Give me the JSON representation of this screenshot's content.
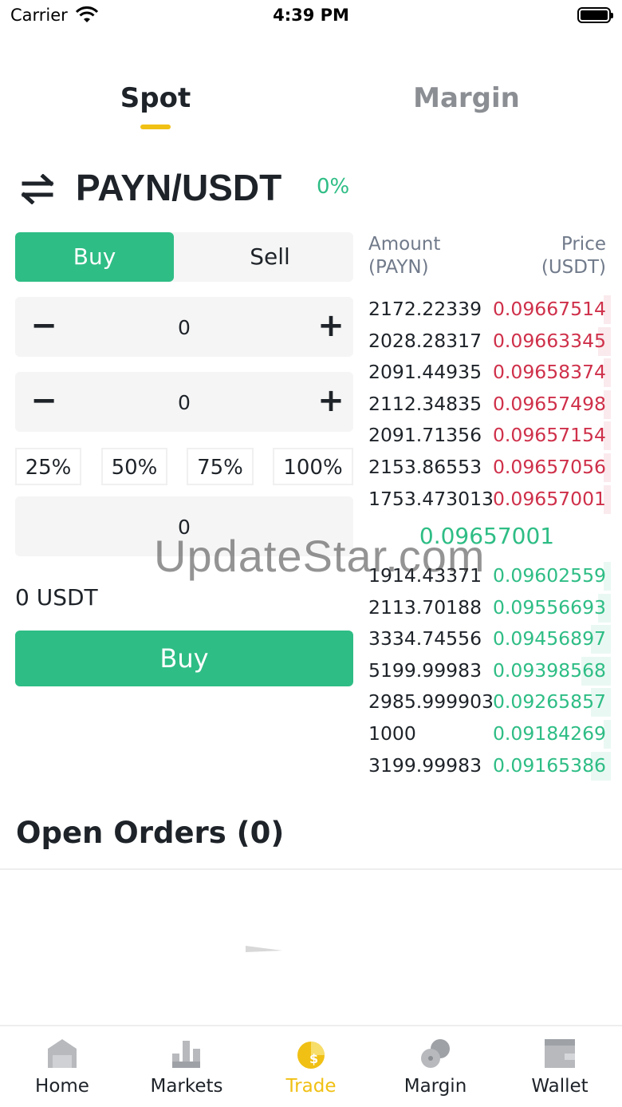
{
  "status_bar": {
    "carrier": "Carrier",
    "time": "4:39 PM"
  },
  "tabs": [
    {
      "label": "Spot",
      "active": true
    },
    {
      "label": "Margin",
      "active": false
    }
  ],
  "pair": {
    "name": "PAYN/USDT",
    "change": "0%"
  },
  "order_form": {
    "buy_label": "Buy",
    "sell_label": "Sell",
    "price_value": "0",
    "amount_value": "0",
    "percent_options": [
      "25%",
      "50%",
      "75%",
      "100%"
    ],
    "total_value": "0",
    "available": "0 USDT",
    "submit_label": "Buy"
  },
  "order_book": {
    "amount_header": [
      "Amount",
      "(PAYN)"
    ],
    "price_header": [
      "Price",
      "(USDT)"
    ],
    "asks": [
      {
        "amount": "2172.22339",
        "price": "0.09667514",
        "depth": 0.03
      },
      {
        "amount": "2028.28317",
        "price": "0.09663345",
        "depth": 0.05
      },
      {
        "amount": "2091.44935",
        "price": "0.09658374",
        "depth": 0.03
      },
      {
        "amount": "2112.34835",
        "price": "0.09657498",
        "depth": 0.03
      },
      {
        "amount": "2091.71356",
        "price": "0.09657154",
        "depth": 0.03
      },
      {
        "amount": "2153.86553",
        "price": "0.09657056",
        "depth": 0.03
      },
      {
        "amount": "1753.473013",
        "price": "0.09657001",
        "depth": 0.03
      }
    ],
    "last_price": "0.09657001",
    "bids": [
      {
        "amount": "1914.43371",
        "price": "0.09602559",
        "depth": 0.03
      },
      {
        "amount": "2113.70188",
        "price": "0.09556693",
        "depth": 0.05
      },
      {
        "amount": "3334.74556",
        "price": "0.09456897",
        "depth": 0.08
      },
      {
        "amount": "5199.99983",
        "price": "0.09398568",
        "depth": 0.12
      },
      {
        "amount": "2985.999903",
        "price": "0.09265857",
        "depth": 0.08
      },
      {
        "amount": "1000",
        "price": "0.09184269",
        "depth": 0.03
      },
      {
        "amount": "3199.99983",
        "price": "0.09165386",
        "depth": 0.08
      }
    ]
  },
  "watermark": "UpdateStar.com",
  "open_orders": {
    "title": "Open Orders (0)"
  },
  "bottom_nav": [
    {
      "label": "Home",
      "icon": "home-icon",
      "active": false
    },
    {
      "label": "Markets",
      "icon": "markets-icon",
      "active": false
    },
    {
      "label": "Trade",
      "icon": "trade-icon",
      "active": true
    },
    {
      "label": "Margin",
      "icon": "margin-icon",
      "active": false
    },
    {
      "label": "Wallet",
      "icon": "wallet-icon",
      "active": false
    }
  ],
  "colors": {
    "buy": "#2ebd85",
    "sell": "#cf304a",
    "accent": "#f0c014",
    "text": "#1e2329",
    "muted": "#8b8e93"
  }
}
